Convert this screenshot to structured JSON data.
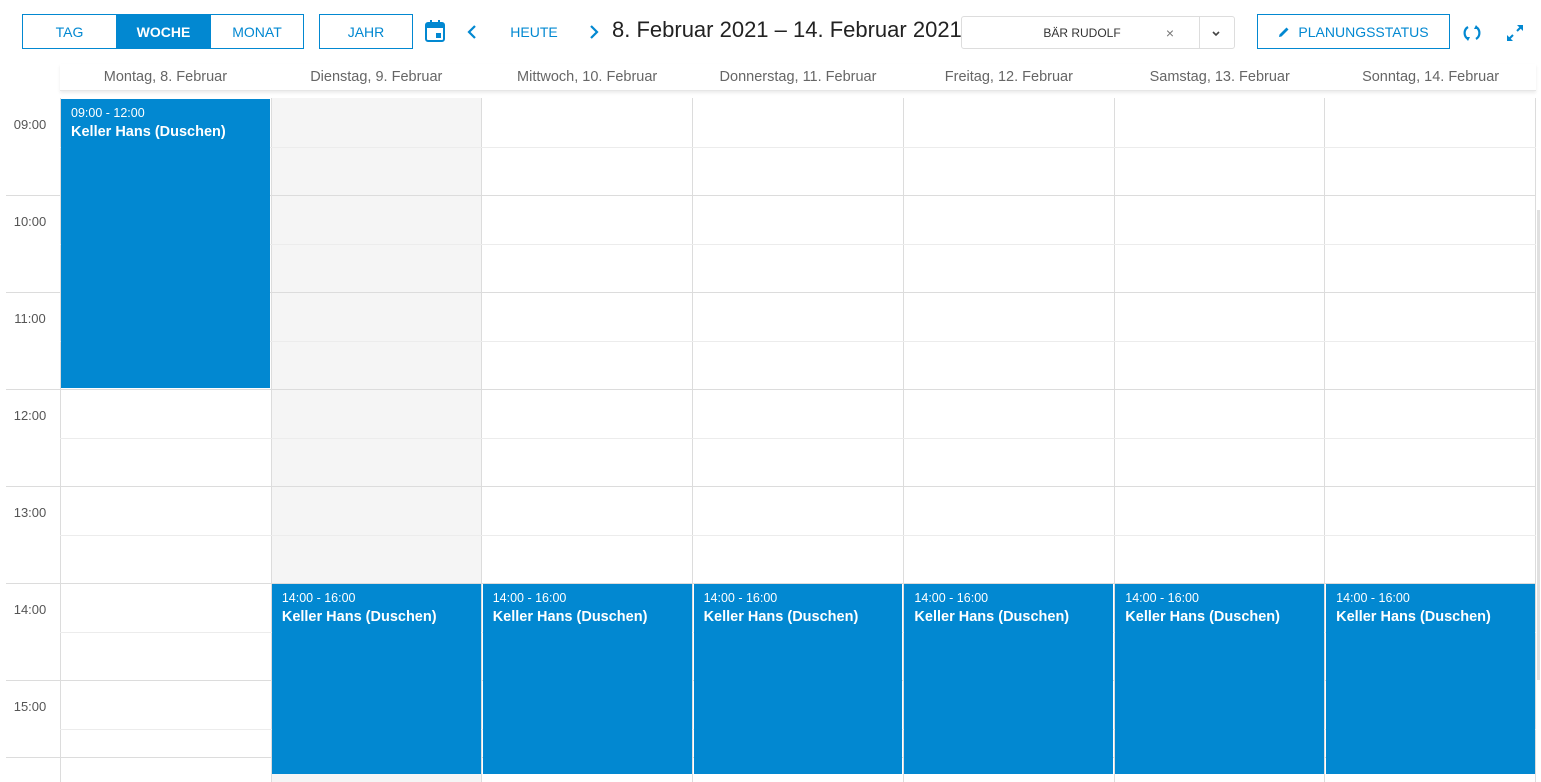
{
  "toolbar": {
    "views": [
      {
        "label": "TAG",
        "active": false
      },
      {
        "label": "WOCHE",
        "active": true
      },
      {
        "label": "MONAT",
        "active": false
      }
    ],
    "year_label": "JAHR",
    "today_label": "HEUTE",
    "range_title": "8. Februar 2021 – 14. Februar 2021",
    "person_value": "BÄR RUDOLF",
    "clear_symbol": "×",
    "status_label": "PLANUNGSSTATUS",
    "accent_color": "#0288d1",
    "icons": [
      "calendar-icon",
      "chevron-left-icon",
      "chevron-right-icon",
      "close-icon",
      "chevron-down-icon",
      "pencil-icon",
      "refresh-icon",
      "expand-icon"
    ]
  },
  "days": [
    "Montag, 8. Februar",
    "Dienstag, 9. Februar",
    "Mittwoch, 10. Februar",
    "Donnerstag, 11. Februar",
    "Freitag, 12. Februar",
    "Samstag, 13. Februar",
    "Sonntag, 14. Februar"
  ],
  "shaded_day_index": 1,
  "hours": [
    "09:00",
    "10:00",
    "11:00",
    "12:00",
    "13:00",
    "14:00",
    "15:00"
  ],
  "events": [
    {
      "day": 0,
      "start": 9,
      "end": 12,
      "time": "09:00 - 12:00",
      "title": "Keller Hans (Duschen)"
    },
    {
      "day": 1,
      "start": 14,
      "end": 16,
      "time": "14:00 - 16:00",
      "title": "Keller Hans (Duschen)"
    },
    {
      "day": 2,
      "start": 14,
      "end": 16,
      "time": "14:00 - 16:00",
      "title": "Keller Hans (Duschen)"
    },
    {
      "day": 3,
      "start": 14,
      "end": 16,
      "time": "14:00 - 16:00",
      "title": "Keller Hans (Duschen)"
    },
    {
      "day": 4,
      "start": 14,
      "end": 16,
      "time": "14:00 - 16:00",
      "title": "Keller Hans (Duschen)"
    },
    {
      "day": 5,
      "start": 14,
      "end": 16,
      "time": "14:00 - 16:00",
      "title": "Keller Hans (Duschen)"
    },
    {
      "day": 6,
      "start": 14,
      "end": 16,
      "time": "14:00 - 16:00",
      "title": "Keller Hans (Duschen)"
    }
  ]
}
